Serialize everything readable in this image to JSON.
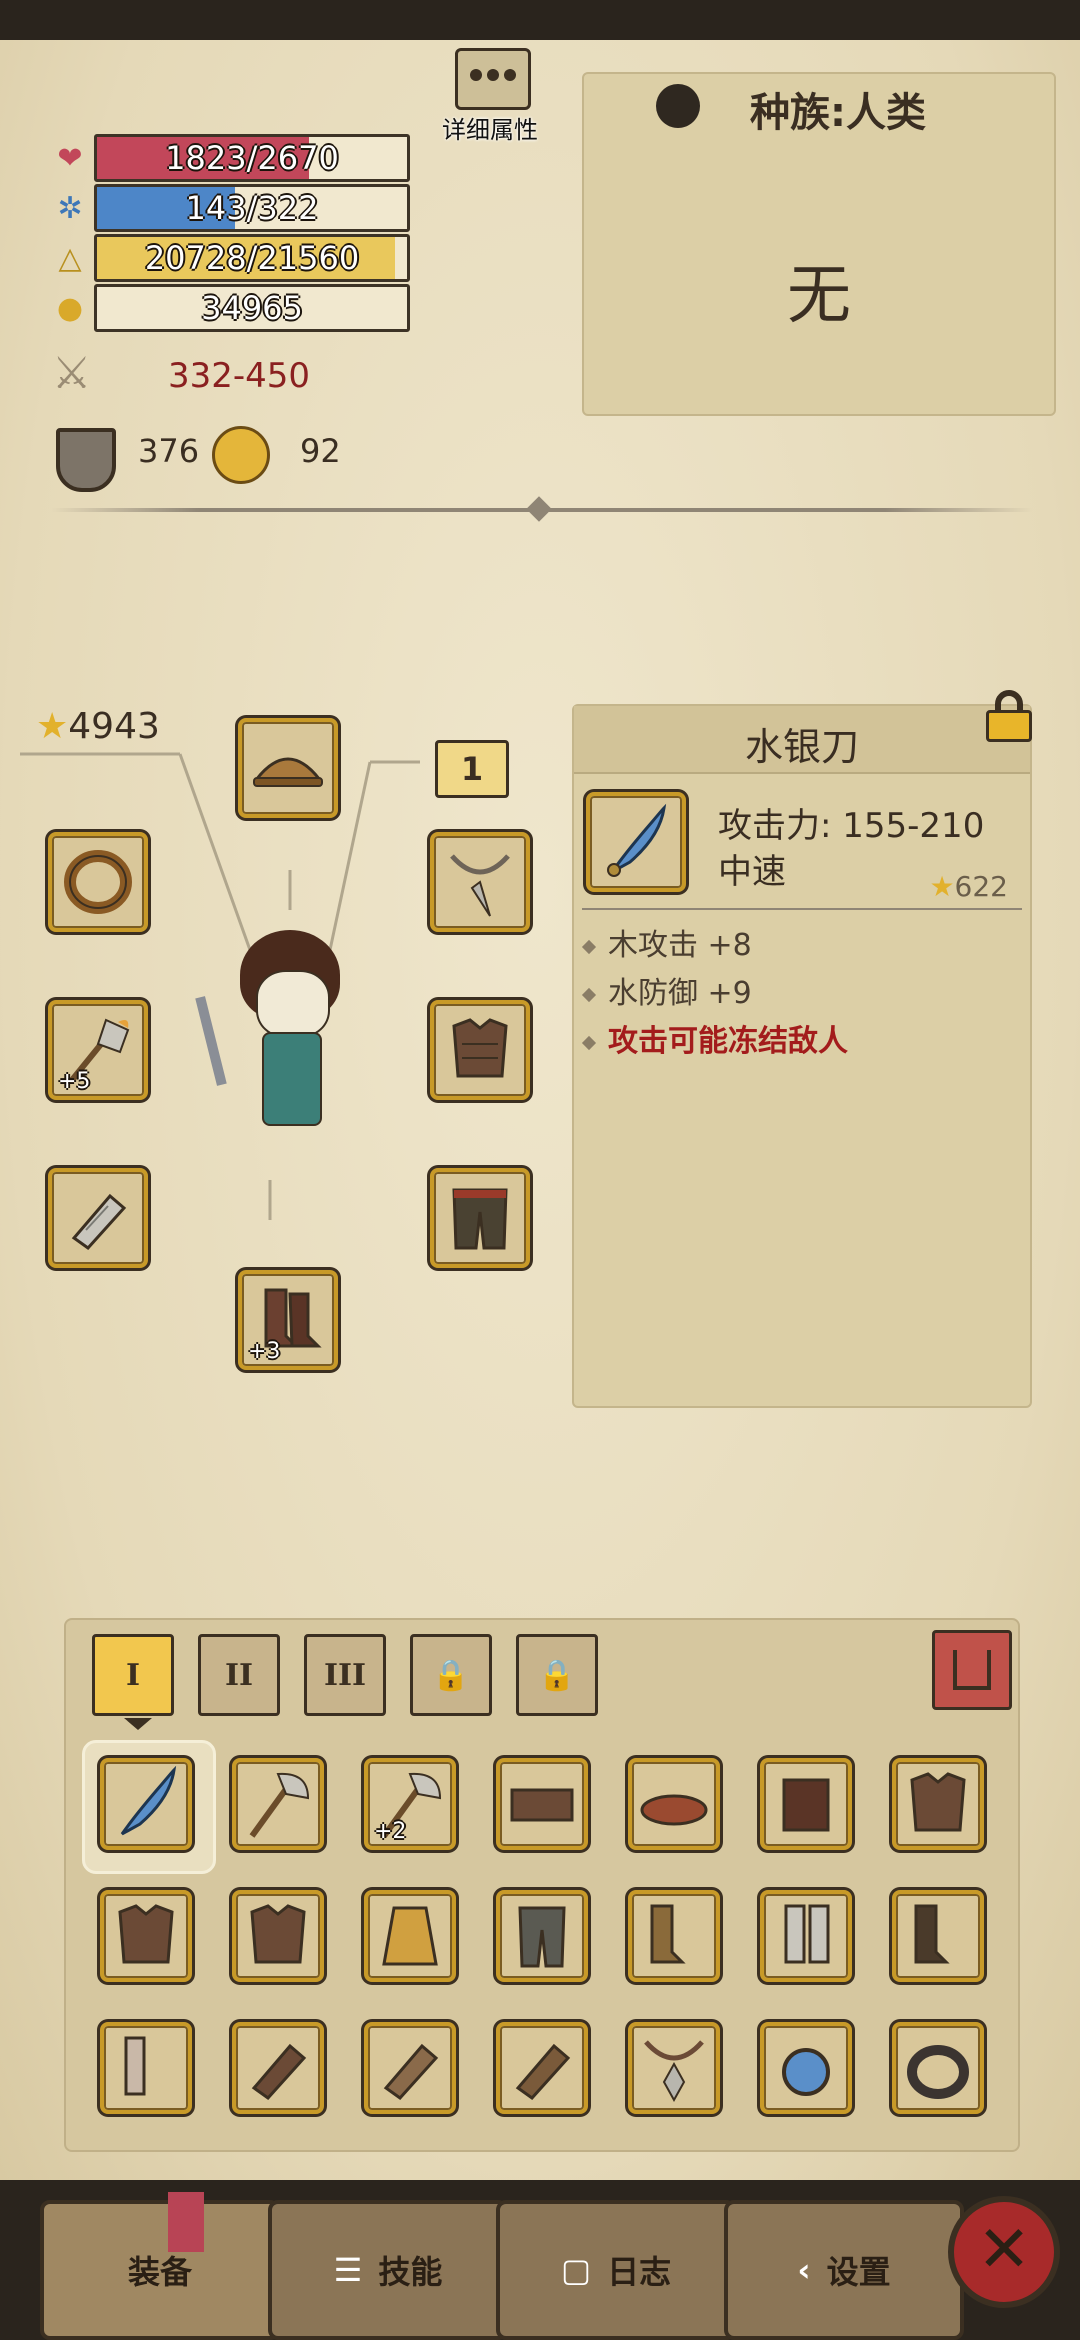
{
  "stats": {
    "hp": {
      "text": "1823/2670",
      "fraction": 0.683,
      "color": "#c2475a"
    },
    "mp": {
      "text": "143/322",
      "fraction": 0.444,
      "color": "#4d86c8"
    },
    "xp": {
      "text": "20728/21560",
      "fraction": 0.961,
      "color": "#e9c85c"
    },
    "gold": {
      "text": "34965"
    },
    "attack": "332-450",
    "defense": "376",
    "magic": "92"
  },
  "details_button": {
    "label": "详细属性"
  },
  "race": {
    "label": "种族:人类",
    "value": "无"
  },
  "score": "4943",
  "level_badge": "1",
  "equip_slots": {
    "weapon_plus": "+5",
    "boots_plus": "+3"
  },
  "item_detail": {
    "name": "水银刀",
    "attack": "攻击力: 155-210",
    "speed": "中速",
    "stars": "622",
    "attrs": [
      "木攻击 +8",
      "水防御 +9"
    ],
    "special": "攻击可能冻结敌人"
  },
  "inventory": {
    "tabs": [
      "I",
      "II",
      "III"
    ],
    "locked_tabs": 2,
    "item_plus": "+2"
  },
  "bottom_nav": {
    "equip": "装备",
    "skills": "技能",
    "log": "日志",
    "settings": "设置"
  },
  "colors": {
    "accent_gold": "#c89a28",
    "special_red": "#a31c1c"
  }
}
